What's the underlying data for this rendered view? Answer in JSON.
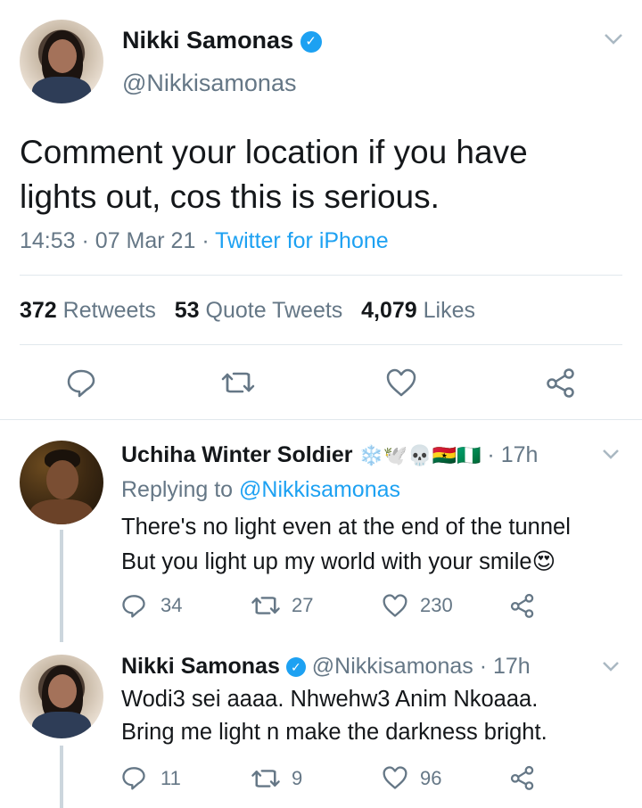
{
  "main_tweet": {
    "author_name": "Nikki Samonas",
    "handle": "@Nikkisamonas",
    "text_line1": "Comment your location if you have",
    "text_line2": "lights out, cos this is serious.",
    "time": "14:53",
    "date": "07 Mar 21",
    "source": "Twitter for iPhone",
    "dot": "·",
    "stats": {
      "retweets_count": "372",
      "retweets_label": "Retweets",
      "quotes_count": "53",
      "quotes_label": "Quote Tweets",
      "likes_count": "4,079",
      "likes_label": "Likes"
    }
  },
  "replies": [
    {
      "author_name": "Uchiha Winter Soldier",
      "name_emoji": "❄️🕊️💀🇬🇭🇳🇬",
      "time": "17h",
      "replying_label": "Replying to",
      "replying_to": "@Nikkisamonas",
      "text_line1": "There's no light even at the end of the tunnel",
      "text_line2": "But you light up my world with your smile😍",
      "reply_count": "34",
      "retweet_count": "27",
      "like_count": "230"
    },
    {
      "author_name": "Nikki Samonas",
      "handle": "@Nikkisamonas",
      "time": "17h",
      "text_line1": "Wodi3 sei aaaa. Nhwehw3 Anim Nkoaaa.",
      "text_line2": "Bring me light n make the darkness bright.",
      "reply_count": "11",
      "retweet_count": "9",
      "like_count": "96"
    }
  ],
  "colors": {
    "accent": "#1da1f2",
    "muted": "#657786",
    "divider": "#e1e8ed"
  }
}
